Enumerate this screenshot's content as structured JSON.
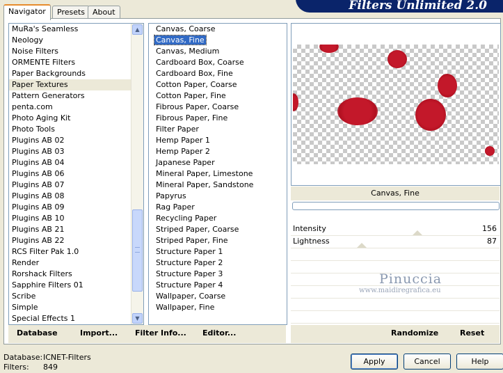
{
  "app": {
    "title": "Filters Unlimited 2.0"
  },
  "tabs": [
    {
      "label": "Navigator",
      "active": true
    },
    {
      "label": "Presets",
      "active": false
    },
    {
      "label": "About",
      "active": false
    }
  ],
  "categories": {
    "items": [
      "MuRa's Seamless",
      "Neology",
      "Noise Filters",
      "ORMENTE Filters",
      "Paper Backgrounds",
      "Paper Textures",
      "Pattern Generators",
      "penta.com",
      "Photo Aging Kit",
      "Photo Tools",
      "Plugins AB 02",
      "Plugins AB 03",
      "Plugins AB 04",
      "Plugins AB 06",
      "Plugins AB 07",
      "Plugins AB 08",
      "Plugins AB 09",
      "Plugins AB 10",
      "Plugins AB 21",
      "Plugins AB 22",
      "RCS Filter Pak 1.0",
      "Render",
      "Rorshack Filters",
      "Sapphire Filters 01",
      "Scribe",
      "Simple",
      "Special Effects 1"
    ],
    "selected": "Paper Textures"
  },
  "filters": {
    "items": [
      "Canvas, Coarse",
      "Canvas, Fine",
      "Canvas, Medium",
      "Cardboard Box, Coarse",
      "Cardboard Box, Fine",
      "Cotton Paper, Coarse",
      "Cotton Paper, Fine",
      "Fibrous Paper, Coarse",
      "Fibrous Paper, Fine",
      "Filter Paper",
      "Hemp Paper 1",
      "Hemp Paper 2",
      "Japanese Paper",
      "Mineral Paper, Limestone",
      "Mineral Paper, Sandstone",
      "Papyrus",
      "Rag Paper",
      "Recycling Paper",
      "Striped Paper, Coarse",
      "Striped Paper, Fine",
      "Structure Paper 1",
      "Structure Paper 2",
      "Structure Paper 3",
      "Structure Paper 4",
      "Wallpaper, Coarse",
      "Wallpaper, Fine"
    ],
    "selected": "Canvas, Fine"
  },
  "preview": {
    "filter_name": "Canvas, Fine",
    "dot_color": "#c3182a"
  },
  "controls": {
    "sliders": [
      {
        "label": "Intensity",
        "value": "156",
        "max": 255
      },
      {
        "label": "Lightness",
        "value": "87",
        "max": 255
      }
    ],
    "randomize_label": "Randomize",
    "reset_label": "Reset"
  },
  "toolbar": {
    "database_label": "Database",
    "import_label": "Import...",
    "filter_info_label": "Filter Info...",
    "editor_label": "Editor..."
  },
  "watermark": {
    "name": "Pinuccia",
    "url": "www.maidiregrafica.eu"
  },
  "footer": {
    "database_key": "Database:",
    "database_value": "ICNET-Filters",
    "filters_key": "Filters:",
    "filters_value": "849",
    "apply_label": "Apply",
    "cancel_label": "Cancel",
    "help_label": "Help"
  }
}
